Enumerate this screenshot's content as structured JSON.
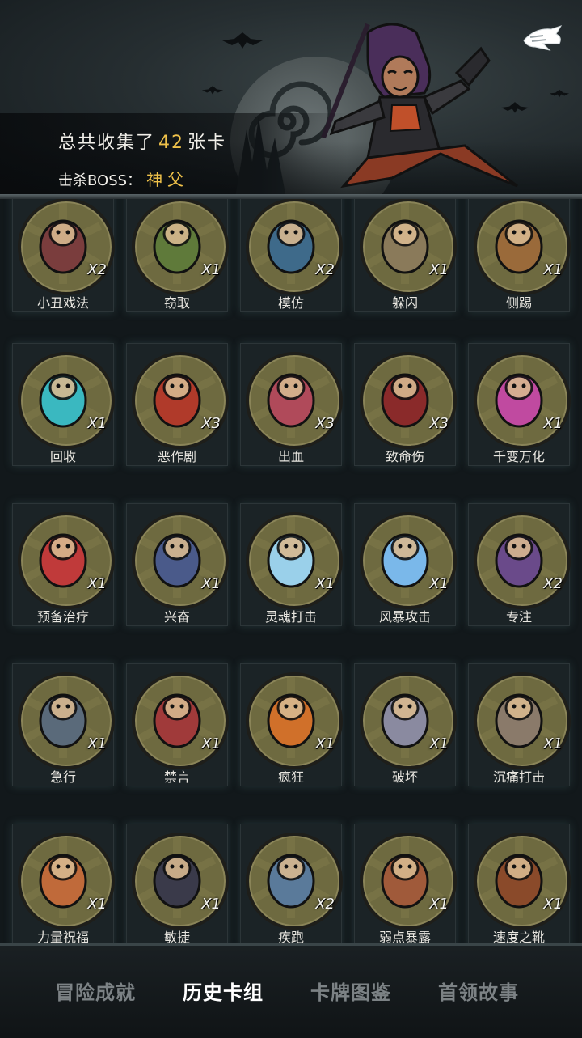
{
  "header": {
    "collected_prefix": "总共收集了",
    "collected_count": "42",
    "collected_suffix": "张卡",
    "boss_label": "击杀BOSS：",
    "boss_name": "神父"
  },
  "cards": [
    {
      "name": "小丑戏法",
      "qty": "X2",
      "icon": "clown-icon",
      "color": "#7a3d3d"
    },
    {
      "name": "窃取",
      "qty": "X1",
      "icon": "goblin-thief-icon",
      "color": "#5f7a3a"
    },
    {
      "name": "模仿",
      "qty": "X2",
      "icon": "blue-troll-icon",
      "color": "#3e6a8a"
    },
    {
      "name": "躲闪",
      "qty": "X1",
      "icon": "dodge-figure-icon",
      "color": "#8a7a5a"
    },
    {
      "name": "侧踢",
      "qty": "X1",
      "icon": "side-kick-icon",
      "color": "#9a6a3a"
    },
    {
      "name": "回收",
      "qty": "X1",
      "icon": "cyan-swirl-icon",
      "color": "#3ab8c0"
    },
    {
      "name": "恶作剧",
      "qty": "X3",
      "icon": "red-toy-icon",
      "color": "#b03a2a"
    },
    {
      "name": "出血",
      "qty": "X3",
      "icon": "bleeding-monster-icon",
      "color": "#b04a5a"
    },
    {
      "name": "致命伤",
      "qty": "X3",
      "icon": "dagger-blood-icon",
      "color": "#8a2a2a"
    },
    {
      "name": "千变万化",
      "qty": "X1",
      "icon": "jack-in-box-icon",
      "color": "#c04aa0"
    },
    {
      "name": "预备治疗",
      "qty": "X1",
      "icon": "heart-cross-icon",
      "color": "#c03a3a"
    },
    {
      "name": "兴奋",
      "qty": "X1",
      "icon": "excited-dwarf-icon",
      "color": "#4a5a8a"
    },
    {
      "name": "灵魂打击",
      "qty": "X1",
      "icon": "ice-burst-icon",
      "color": "#9ad0ea"
    },
    {
      "name": "风暴攻击",
      "qty": "X1",
      "icon": "lightning-burst-icon",
      "color": "#7ab8ea"
    },
    {
      "name": "专注",
      "qty": "X2",
      "icon": "wizard-icon",
      "color": "#6a4a8a"
    },
    {
      "name": "急行",
      "qty": "X1",
      "icon": "running-warrior-icon",
      "color": "#5a6a7a"
    },
    {
      "name": "禁言",
      "qty": "X1",
      "icon": "hooded-girl-icon",
      "color": "#a03a3a"
    },
    {
      "name": "疯狂",
      "qty": "X1",
      "icon": "pumpkin-head-icon",
      "color": "#d0702a"
    },
    {
      "name": "破坏",
      "qty": "X1",
      "icon": "hammer-hand-icon",
      "color": "#8a8aa0"
    },
    {
      "name": "沉痛打击",
      "qty": "X1",
      "icon": "brute-strike-icon",
      "color": "#8a7a6a"
    },
    {
      "name": "力量祝福",
      "qty": "X1",
      "icon": "fist-icon",
      "color": "#c06a3a"
    },
    {
      "name": "敏捷",
      "qty": "X1",
      "icon": "black-panther-icon",
      "color": "#3a3a4a"
    },
    {
      "name": "疾跑",
      "qty": "X2",
      "icon": "sprinting-wolf-icon",
      "color": "#5a7a9a"
    },
    {
      "name": "弱点暴露",
      "qty": "X1",
      "icon": "foot-stab-icon",
      "color": "#a05a3a"
    },
    {
      "name": "速度之靴",
      "qty": "X1",
      "icon": "boot-icon",
      "color": "#8a4a2a"
    }
  ],
  "tabs": [
    {
      "label": "冒险成就",
      "active": false
    },
    {
      "label": "历史卡组",
      "active": true
    },
    {
      "label": "卡牌图鉴",
      "active": false
    },
    {
      "label": "首领故事",
      "active": false
    }
  ]
}
